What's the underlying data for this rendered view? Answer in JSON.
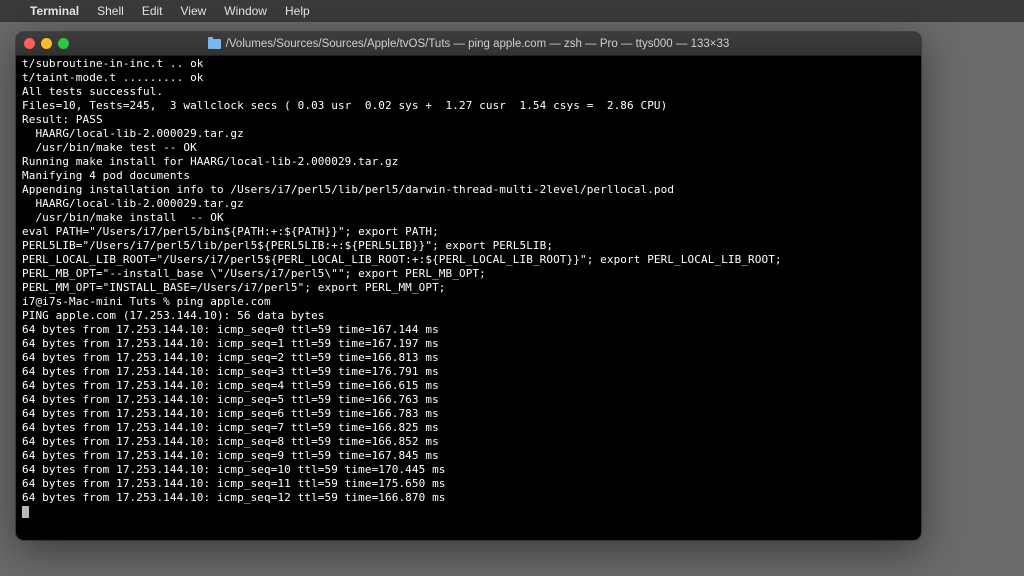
{
  "menubar": {
    "apple": "",
    "app": "Terminal",
    "items": [
      "Shell",
      "Edit",
      "View",
      "Window",
      "Help"
    ]
  },
  "window": {
    "title": "/Volumes/Sources/Sources/Apple/tvOS/Tuts — ping apple.com — zsh — Pro — ttys000 — 133×33"
  },
  "terminal": {
    "lines": [
      "t/subroutine-in-inc.t .. ok",
      "t/taint-mode.t ......... ok",
      "All tests successful.",
      "Files=10, Tests=245,  3 wallclock secs ( 0.03 usr  0.02 sys +  1.27 cusr  1.54 csys =  2.86 CPU)",
      "Result: PASS",
      "  HAARG/local-lib-2.000029.tar.gz",
      "  /usr/bin/make test -- OK",
      "Running make install for HAARG/local-lib-2.000029.tar.gz",
      "Manifying 4 pod documents",
      "Appending installation info to /Users/i7/perl5/lib/perl5/darwin-thread-multi-2level/perllocal.pod",
      "  HAARG/local-lib-2.000029.tar.gz",
      "  /usr/bin/make install  -- OK",
      "eval PATH=\"/Users/i7/perl5/bin${PATH:+:${PATH}}\"; export PATH;",
      "PERL5LIB=\"/Users/i7/perl5/lib/perl5${PERL5LIB:+:${PERL5LIB}}\"; export PERL5LIB;",
      "PERL_LOCAL_LIB_ROOT=\"/Users/i7/perl5${PERL_LOCAL_LIB_ROOT:+:${PERL_LOCAL_LIB_ROOT}}\"; export PERL_LOCAL_LIB_ROOT;",
      "PERL_MB_OPT=\"--install_base \\\"/Users/i7/perl5\\\"\"; export PERL_MB_OPT;",
      "PERL_MM_OPT=\"INSTALL_BASE=/Users/i7/perl5\"; export PERL_MM_OPT;",
      "i7@i7s-Mac-mini Tuts % ping apple.com",
      "PING apple.com (17.253.144.10): 56 data bytes",
      "64 bytes from 17.253.144.10: icmp_seq=0 ttl=59 time=167.144 ms",
      "64 bytes from 17.253.144.10: icmp_seq=1 ttl=59 time=167.197 ms",
      "64 bytes from 17.253.144.10: icmp_seq=2 ttl=59 time=166.813 ms",
      "64 bytes from 17.253.144.10: icmp_seq=3 ttl=59 time=176.791 ms",
      "64 bytes from 17.253.144.10: icmp_seq=4 ttl=59 time=166.615 ms",
      "64 bytes from 17.253.144.10: icmp_seq=5 ttl=59 time=166.763 ms",
      "64 bytes from 17.253.144.10: icmp_seq=6 ttl=59 time=166.783 ms",
      "64 bytes from 17.253.144.10: icmp_seq=7 ttl=59 time=166.825 ms",
      "64 bytes from 17.253.144.10: icmp_seq=8 ttl=59 time=166.852 ms",
      "64 bytes from 17.253.144.10: icmp_seq=9 ttl=59 time=167.845 ms",
      "64 bytes from 17.253.144.10: icmp_seq=10 ttl=59 time=170.445 ms",
      "64 bytes from 17.253.144.10: icmp_seq=11 ttl=59 time=175.650 ms",
      "64 bytes from 17.253.144.10: icmp_seq=12 ttl=59 time=166.870 ms"
    ]
  }
}
